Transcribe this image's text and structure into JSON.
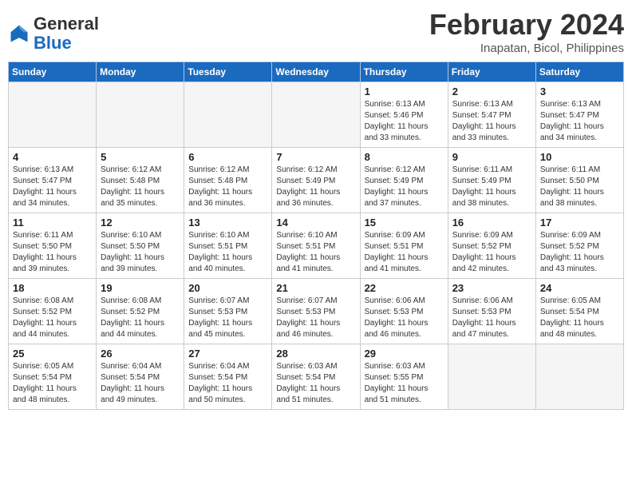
{
  "header": {
    "logo": {
      "line1": "General",
      "line2": "Blue"
    },
    "title": "February 2024",
    "location": "Inapatan, Bicol, Philippines"
  },
  "days_of_week": [
    "Sunday",
    "Monday",
    "Tuesday",
    "Wednesday",
    "Thursday",
    "Friday",
    "Saturday"
  ],
  "weeks": [
    [
      {
        "num": "",
        "info": ""
      },
      {
        "num": "",
        "info": ""
      },
      {
        "num": "",
        "info": ""
      },
      {
        "num": "",
        "info": ""
      },
      {
        "num": "1",
        "info": "Sunrise: 6:13 AM\nSunset: 5:46 PM\nDaylight: 11 hours\nand 33 minutes."
      },
      {
        "num": "2",
        "info": "Sunrise: 6:13 AM\nSunset: 5:47 PM\nDaylight: 11 hours\nand 33 minutes."
      },
      {
        "num": "3",
        "info": "Sunrise: 6:13 AM\nSunset: 5:47 PM\nDaylight: 11 hours\nand 34 minutes."
      }
    ],
    [
      {
        "num": "4",
        "info": "Sunrise: 6:13 AM\nSunset: 5:47 PM\nDaylight: 11 hours\nand 34 minutes."
      },
      {
        "num": "5",
        "info": "Sunrise: 6:12 AM\nSunset: 5:48 PM\nDaylight: 11 hours\nand 35 minutes."
      },
      {
        "num": "6",
        "info": "Sunrise: 6:12 AM\nSunset: 5:48 PM\nDaylight: 11 hours\nand 36 minutes."
      },
      {
        "num": "7",
        "info": "Sunrise: 6:12 AM\nSunset: 5:49 PM\nDaylight: 11 hours\nand 36 minutes."
      },
      {
        "num": "8",
        "info": "Sunrise: 6:12 AM\nSunset: 5:49 PM\nDaylight: 11 hours\nand 37 minutes."
      },
      {
        "num": "9",
        "info": "Sunrise: 6:11 AM\nSunset: 5:49 PM\nDaylight: 11 hours\nand 38 minutes."
      },
      {
        "num": "10",
        "info": "Sunrise: 6:11 AM\nSunset: 5:50 PM\nDaylight: 11 hours\nand 38 minutes."
      }
    ],
    [
      {
        "num": "11",
        "info": "Sunrise: 6:11 AM\nSunset: 5:50 PM\nDaylight: 11 hours\nand 39 minutes."
      },
      {
        "num": "12",
        "info": "Sunrise: 6:10 AM\nSunset: 5:50 PM\nDaylight: 11 hours\nand 39 minutes."
      },
      {
        "num": "13",
        "info": "Sunrise: 6:10 AM\nSunset: 5:51 PM\nDaylight: 11 hours\nand 40 minutes."
      },
      {
        "num": "14",
        "info": "Sunrise: 6:10 AM\nSunset: 5:51 PM\nDaylight: 11 hours\nand 41 minutes."
      },
      {
        "num": "15",
        "info": "Sunrise: 6:09 AM\nSunset: 5:51 PM\nDaylight: 11 hours\nand 41 minutes."
      },
      {
        "num": "16",
        "info": "Sunrise: 6:09 AM\nSunset: 5:52 PM\nDaylight: 11 hours\nand 42 minutes."
      },
      {
        "num": "17",
        "info": "Sunrise: 6:09 AM\nSunset: 5:52 PM\nDaylight: 11 hours\nand 43 minutes."
      }
    ],
    [
      {
        "num": "18",
        "info": "Sunrise: 6:08 AM\nSunset: 5:52 PM\nDaylight: 11 hours\nand 44 minutes."
      },
      {
        "num": "19",
        "info": "Sunrise: 6:08 AM\nSunset: 5:52 PM\nDaylight: 11 hours\nand 44 minutes."
      },
      {
        "num": "20",
        "info": "Sunrise: 6:07 AM\nSunset: 5:53 PM\nDaylight: 11 hours\nand 45 minutes."
      },
      {
        "num": "21",
        "info": "Sunrise: 6:07 AM\nSunset: 5:53 PM\nDaylight: 11 hours\nand 46 minutes."
      },
      {
        "num": "22",
        "info": "Sunrise: 6:06 AM\nSunset: 5:53 PM\nDaylight: 11 hours\nand 46 minutes."
      },
      {
        "num": "23",
        "info": "Sunrise: 6:06 AM\nSunset: 5:53 PM\nDaylight: 11 hours\nand 47 minutes."
      },
      {
        "num": "24",
        "info": "Sunrise: 6:05 AM\nSunset: 5:54 PM\nDaylight: 11 hours\nand 48 minutes."
      }
    ],
    [
      {
        "num": "25",
        "info": "Sunrise: 6:05 AM\nSunset: 5:54 PM\nDaylight: 11 hours\nand 48 minutes."
      },
      {
        "num": "26",
        "info": "Sunrise: 6:04 AM\nSunset: 5:54 PM\nDaylight: 11 hours\nand 49 minutes."
      },
      {
        "num": "27",
        "info": "Sunrise: 6:04 AM\nSunset: 5:54 PM\nDaylight: 11 hours\nand 50 minutes."
      },
      {
        "num": "28",
        "info": "Sunrise: 6:03 AM\nSunset: 5:54 PM\nDaylight: 11 hours\nand 51 minutes."
      },
      {
        "num": "29",
        "info": "Sunrise: 6:03 AM\nSunset: 5:55 PM\nDaylight: 11 hours\nand 51 minutes."
      },
      {
        "num": "",
        "info": ""
      },
      {
        "num": "",
        "info": ""
      }
    ]
  ]
}
